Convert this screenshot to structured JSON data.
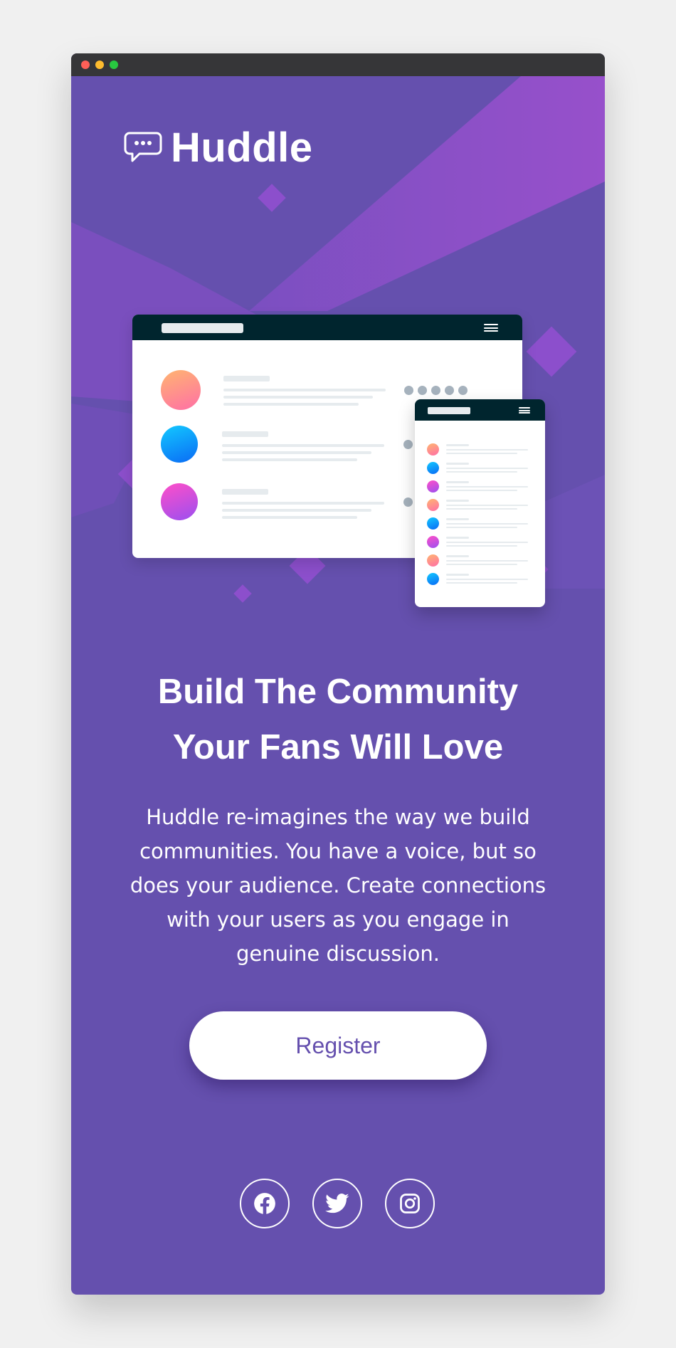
{
  "brand": {
    "name": "Huddle"
  },
  "hero": {
    "headline_line1": "Build The Community",
    "headline_line2": "Your Fans Will Love",
    "description": "Huddle re-imagines the way we build communities. You have a voice, but so does your audience. Create connections with your users as you engage in genuine discussion."
  },
  "cta": {
    "register_label": "Register"
  },
  "social": [
    {
      "name": "Facebook",
      "icon": "facebook-icon"
    },
    {
      "name": "Twitter",
      "icon": "twitter-icon"
    },
    {
      "name": "Instagram",
      "icon": "instagram-icon"
    }
  ],
  "colors": {
    "page_background": "#f0f0f0",
    "brand_violet": "#6550ae",
    "magenta_accent": "#9b4fcc",
    "mockup_header": "#00252e",
    "placeholder_line": "#e6ebee",
    "avatar_dot_gray": "#a6b2bd"
  }
}
